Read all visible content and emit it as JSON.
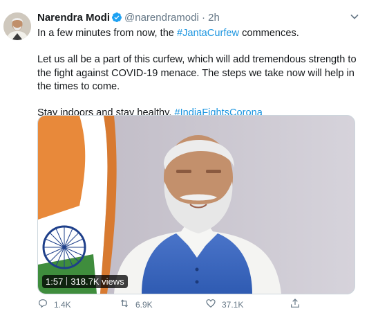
{
  "tweet": {
    "author_name": "Narendra Modi",
    "handle": "@narendramodi",
    "separator": "·",
    "time": "2h",
    "line1_prefix": "In a few minutes from now, the ",
    "line1_hashtag": "#JantaCurfew",
    "line1_suffix": " commences.",
    "paragraph2": "Let us all be a part of this curfew, which will add tremendous strength to the fight against COVID-19 menace. The steps we take now will help in the times to come.",
    "line3_prefix": "Stay indoors and stay healthy. ",
    "line3_hashtag": "#IndiaFightsCorona",
    "colors": {
      "link": "#1b95e0",
      "verified": "#1da1f2",
      "muted": "#657786"
    }
  },
  "video": {
    "duration": "1:57",
    "views": "318.7K views"
  },
  "actions": {
    "reply_count": "1.4K",
    "retweet_count": "6.9K",
    "like_count": "37.1K",
    "icons": [
      "reply-icon",
      "retweet-icon",
      "like-icon",
      "share-icon"
    ]
  }
}
